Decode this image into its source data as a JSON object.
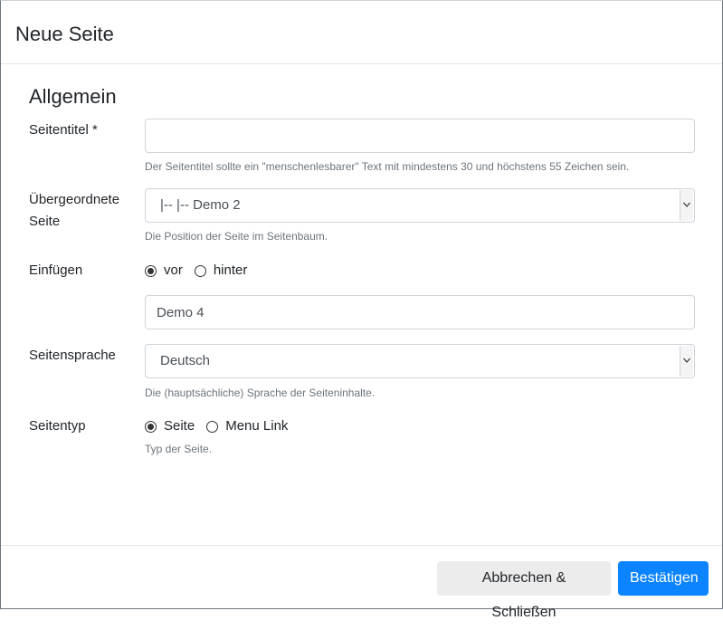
{
  "modal": {
    "title": "Neue Seite",
    "section_title": "Allgemein"
  },
  "form": {
    "page_title": {
      "label": "Seitentitel *",
      "value": "",
      "help": "Der Seitentitel sollte ein \"menschenlesbarer\" Text mit mindestens 30 und höchstens 55 Zeichen sein."
    },
    "parent_page": {
      "label_line1": "Übergeordnete",
      "label_line2": "Seite",
      "selected": "|-- |-- Demo 2",
      "help": "Die Position der Seite im Seitenbaum."
    },
    "insert": {
      "label": "Einfügen",
      "options": [
        {
          "label": "vor",
          "checked": true
        },
        {
          "label": "hinter",
          "checked": false
        }
      ],
      "reference_value": "Demo 4"
    },
    "language": {
      "label": "Seitensprache",
      "selected": "Deutsch",
      "help": "Die (hauptsächliche) Sprache der Seiteninhalte."
    },
    "page_type": {
      "label": "Seitentyp",
      "options": [
        {
          "label": "Seite",
          "checked": true
        },
        {
          "label": "Menu Link",
          "checked": false
        }
      ],
      "help": "Typ der Seite."
    }
  },
  "footer": {
    "cancel_label": "Abbrechen & Schließen",
    "confirm_label": "Bestätigen"
  },
  "colors": {
    "primary": "#0d84ff",
    "secondary_bg": "#ececec",
    "help_text": "#6c757d"
  }
}
